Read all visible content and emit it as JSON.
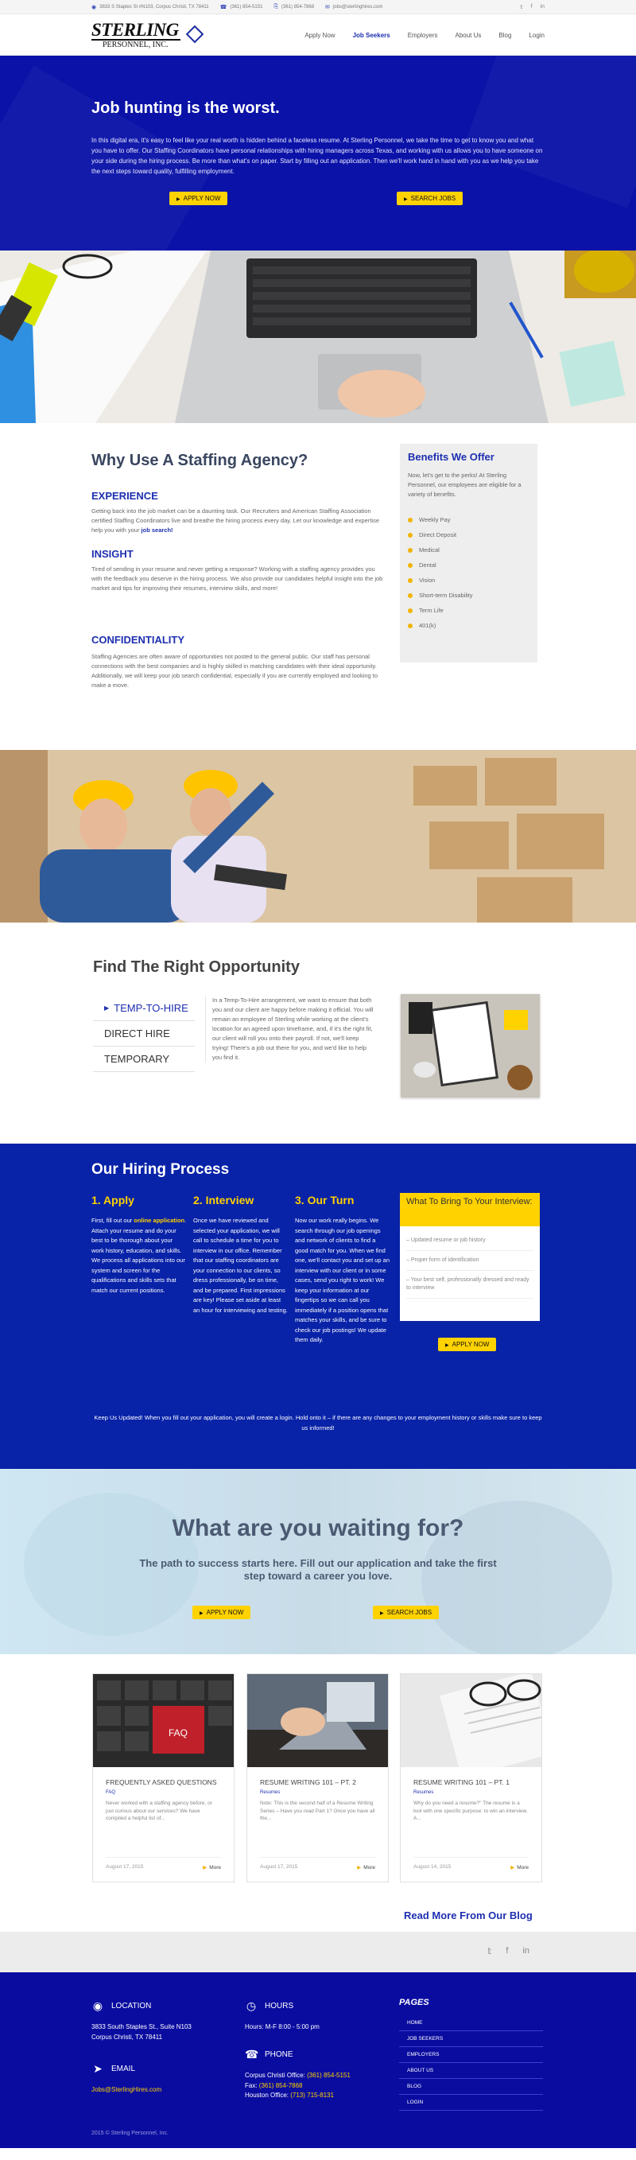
{
  "topbar": {
    "address": "3833 S Staples St #N103, Corpus Christi, TX 78411",
    "phone": "(361) 854-5151",
    "fax": "(361) 854-7868",
    "email": "jobs@sterlinghires.com",
    "icons": [
      "map-pin-icon",
      "phone-icon",
      "fax-icon",
      "mail-icon"
    ],
    "social": [
      "twitter-icon",
      "facebook-icon",
      "linkedin-icon"
    ]
  },
  "header": {
    "logo_top": "STERLING",
    "logo_bottom": "PERSONNEL, INC.",
    "nav": [
      "Apply Now",
      "Job Seekers",
      "Employers",
      "About Us",
      "Blog",
      "Login"
    ],
    "active_nav": "Job Seekers"
  },
  "hero": {
    "title": "Job hunting is the worst.",
    "text": "In this digital era, it's easy to feel like your real worth is hidden behind a faceless resume. At Sterling Personnel, we take the time to get to know you and what you have to offer. Our Staffing Coordinators have personal relationships with hiring managers across Texas, and working with us allows you to have someone on your side during the hiring process. Be more than what's on paper. Start by filling out an application. Then we'll work hand in hand with you as we help you take the next steps toward quality, fulfilling employment.",
    "apply_label": "APPLY NOW",
    "search_label": "SEARCH JOBS"
  },
  "why": {
    "title": "Why Use A Staffing Agency?",
    "sections": [
      {
        "heading": "EXPERIENCE",
        "text": "Getting back into the job market can be a daunting task. Our Recruiters and American Staffing Association certified Staffing Coordinators live and breathe the hiring process every day. Let our knowledge and expertise help you with your",
        "link": "job search!"
      },
      {
        "heading": "INSIGHT",
        "text": "Tired of sending in your resume and never getting a response? Working with a staffing agency provides you with the feedback you deserve in the hiring process. We also provide our candidates helpful insight into the job market and tips for improving their resumes, interview skills, and more!"
      },
      {
        "heading": "CONFIDENTIALITY",
        "text": "Staffing Agencies are often aware of opportunities not posted to the general public. Our staff has personal connections with the best companies and is highly skilled in matching candidates with their ideal opportunity. Additionally, we will keep your job search confidential, especially if you are currently employed and looking to make a move."
      }
    ]
  },
  "benefits": {
    "title": "Benefits We Offer",
    "intro": "Now, let's get to the perks! At Sterling Personnel, our employees are eligible for a variety of benefits.",
    "items": [
      "Weekly Pay",
      "Direct Deposit",
      "Medical",
      "Dental",
      "Vision",
      "Short-term Disability",
      "Term Life",
      "401(k)"
    ]
  },
  "opportunity": {
    "title": "Find The Right Opportunity",
    "tabs": [
      "TEMP-TO-HIRE",
      "DIRECT HIRE",
      "TEMPORARY"
    ],
    "active_tab": "TEMP-TO-HIRE",
    "text": "In a Temp-To-Hire arrangement, we want to ensure that both you and our client are happy before making it official. You will remain an employee of Sterling while working at the client's location for an agreed upon timeframe, and, if it's the right fit, our client will roll you onto their payroll. If not, we'll keep trying! There's a job out there for you, and we'd like to help you find it."
  },
  "hiring": {
    "title": "Our Hiring Process",
    "steps": [
      {
        "heading": "1. Apply",
        "pre": "First, fill out our",
        "link": "online application",
        "text": ". Attach your resume and do your best to be thorough about your work history, education, and skills. We process all applications into our system and screen for the qualifications and skills sets that match our current positions."
      },
      {
        "heading": "2. Interview",
        "text": "Once we have reviewed and selected your application, we will call to schedule a time for you to interview in our office. Remember that our staffing coordinators are your connection to our clients, so dress professionally, be on time, and be prepared. First impressions are key! Please set aside at least an hour for interviewing and testing."
      },
      {
        "heading": "3. Our Turn",
        "text": "Now our work really begins. We search through our job openings and network of clients to find a good match for you. When we find one, we'll contact you and set up an interview with our client or in some cases, send you right to work! We keep your information at our fingertips so we can call you immediately if a position opens that matches your skills, and be sure to check our job postings! We update them daily."
      }
    ],
    "bring_title": "What To Bring To Your Interview:",
    "bring_items": [
      "– Updated resume or job history",
      "– Proper form of identification",
      "– Your best self, professionally dressed and ready to interview"
    ],
    "bring_button": "APPLY NOW",
    "note": "Keep Us Updated! When you fill out your application, you will create a login. Hold onto it – if there are any changes to your employment history or skills make sure to keep us informed!"
  },
  "waiting": {
    "title": "What are you waiting for?",
    "text": "The path to success starts here. Fill out our application and take the first step toward a career you love.",
    "apply_label": "APPLY NOW",
    "search_label": "SEARCH JOBS"
  },
  "blog": {
    "posts": [
      {
        "title": "FREQUENTLY ASKED QUESTIONS",
        "category": "FAQ",
        "excerpt": "Never worked with a staffing agency before, or just curious about our services? We have compiled a helpful list of...",
        "date": "August 17, 2015",
        "more": "More",
        "photo_text": "FAQ"
      },
      {
        "title": "RESUME WRITING 101 – PT. 2",
        "category": "Resumes",
        "excerpt": "Note: This is the second half of a Resume Writing Series – Have you read Part 1? Once you have all the...",
        "date": "August 17, 2015",
        "more": "More"
      },
      {
        "title": "RESUME WRITING 101 – PT. 1",
        "category": "Resumes",
        "excerpt": "Why do you need a resume?\" The resume is a tool with one specific purpose: to win an interview. A...",
        "date": "August 14, 2015",
        "more": "More"
      }
    ],
    "read_more": "Read More From Our Blog"
  },
  "social_icons": [
    "twitter-icon",
    "facebook-icon",
    "linkedin-icon"
  ],
  "footer": {
    "location_label": "LOCATION",
    "location_lines": [
      "3833 South Staples St., Suite N103",
      "Corpus Christi, TX 78411"
    ],
    "email_label": "EMAIL",
    "email": "Jobs@SterlingHires.com",
    "hours_label": "HOURS",
    "hours": "Hours: M-F 8:00 - 5:00 pm",
    "phone_label": "PHONE",
    "phones": [
      {
        "label": "Corpus Christi Office:",
        "value": "(361) 854-5151"
      },
      {
        "label": "Fax:",
        "value": "(361) 854-7868"
      },
      {
        "label": "Houston Office:",
        "value": "(713) 715-8131"
      }
    ],
    "pages_label": "PAGES",
    "pages": [
      "HOME",
      "JOB SEEKERS",
      "EMPLOYERS",
      "ABOUT US",
      "BLOG",
      "LOGIN"
    ],
    "copyright": "2015 © Sterling Personnel, Inc."
  },
  "colors": {
    "brand_blue": "#0a12a8",
    "accent_yellow": "#ffd200",
    "link_blue": "#1d2fb0"
  }
}
